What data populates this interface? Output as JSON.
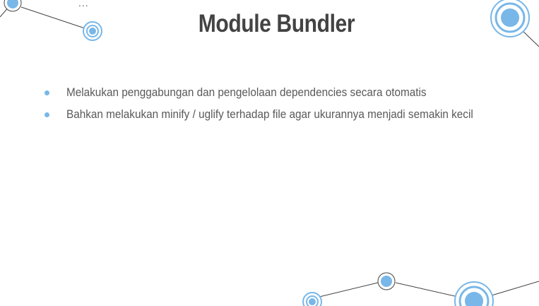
{
  "slide": {
    "title": "Module Bundler",
    "ellipsis": "...",
    "bullets": [
      {
        "text": "Melakukan penggabungan dan pengelolaan dependencies secara otomatis"
      },
      {
        "text": "Bahkan melakukan minify / uglify terhadap file agar ukurannya menjadi semakin kecil"
      }
    ]
  },
  "colors": {
    "title": "#434343",
    "body_text": "#595959",
    "accent_blue": "#78b7e8",
    "accent_ring": "#5aa7e6",
    "line": "#434343"
  }
}
